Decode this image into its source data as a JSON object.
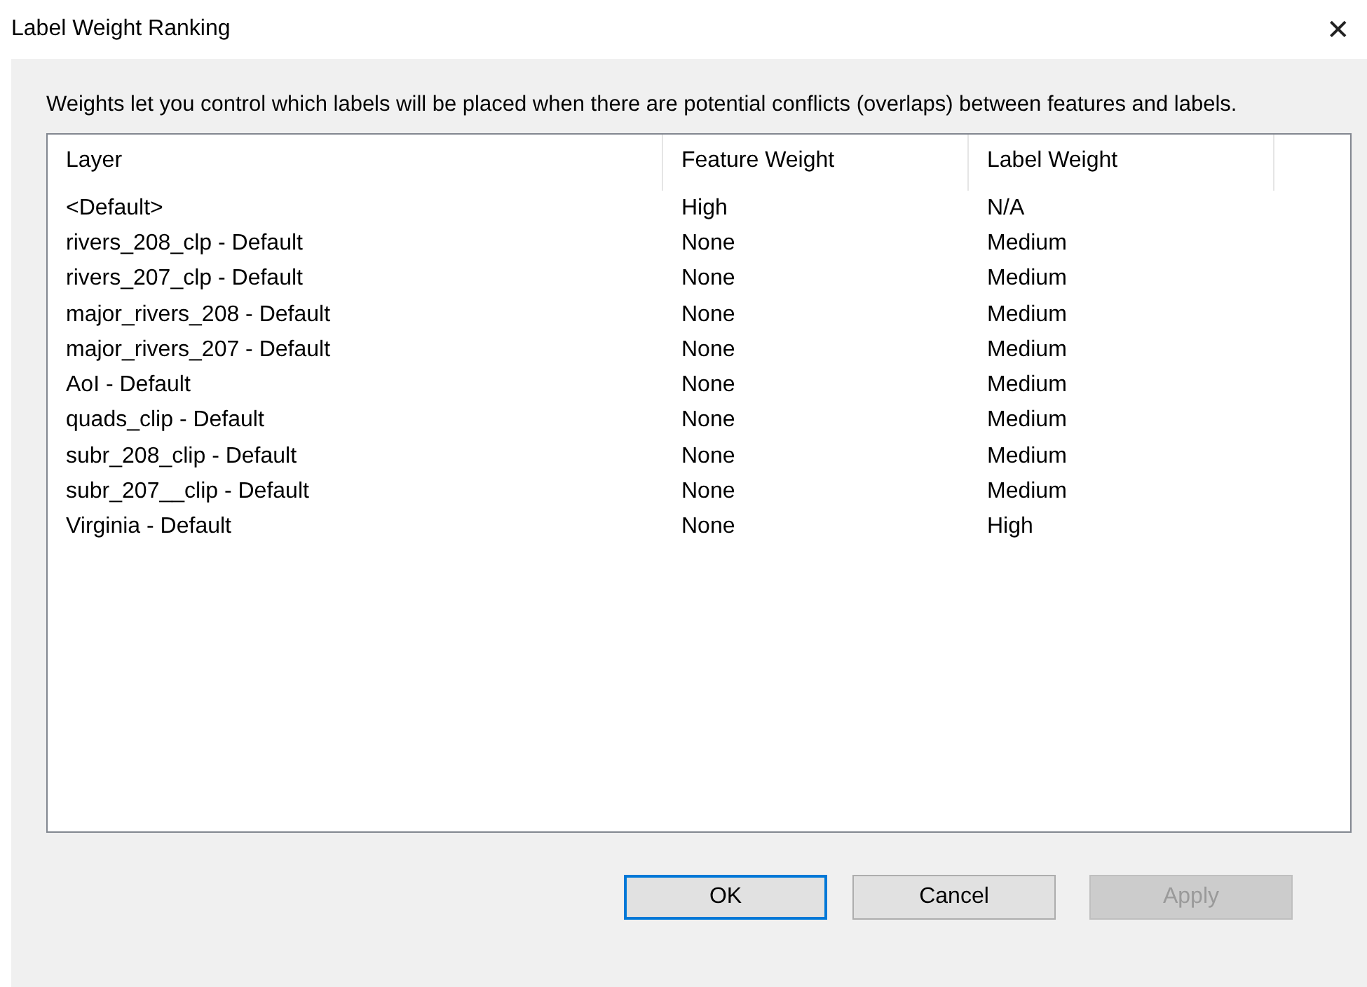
{
  "window": {
    "title": "Label Weight Ranking",
    "close": "✕"
  },
  "description": "Weights let you control which labels will be placed when there are potential conflicts (overlaps) between features and labels.",
  "table": {
    "columns": [
      "Layer",
      "Feature Weight",
      "Label Weight"
    ],
    "rows": [
      [
        "<Default>",
        "High",
        "N/A"
      ],
      [
        "rivers_208_clp - Default",
        "None",
        "Medium"
      ],
      [
        "rivers_207_clp - Default",
        "None",
        "Medium"
      ],
      [
        "major_rivers_208 - Default",
        "None",
        "Medium"
      ],
      [
        "major_rivers_207 - Default",
        "None",
        "Medium"
      ],
      [
        "AoI - Default",
        "None",
        "Medium"
      ],
      [
        "quads_clip - Default",
        "None",
        "Medium"
      ],
      [
        "subr_208_clip - Default",
        "None",
        "Medium"
      ],
      [
        "subr_207__clip - Default",
        "None",
        "Medium"
      ],
      [
        "Virginia - Default",
        "None",
        "High"
      ]
    ]
  },
  "buttons": [
    {
      "label": "OK",
      "default": true,
      "disabled": false
    },
    {
      "label": "Cancel",
      "default": false,
      "disabled": false
    },
    {
      "label": "Apply",
      "default": false,
      "disabled": true
    }
  ]
}
